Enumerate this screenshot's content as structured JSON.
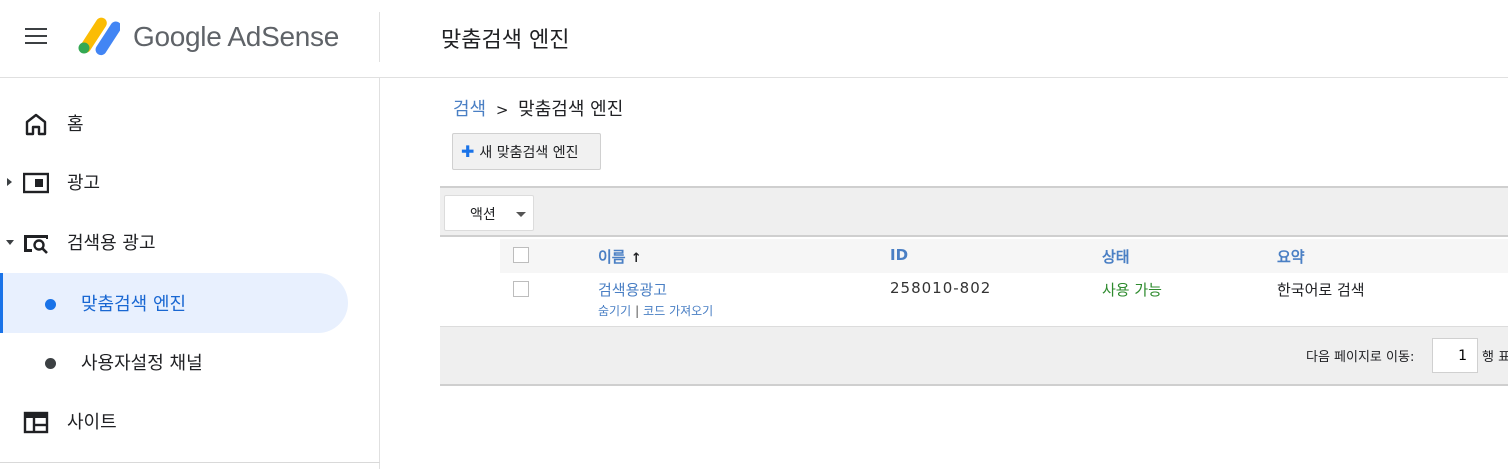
{
  "header": {
    "brand": "Google AdSense",
    "page_title": "맞춤검색 엔진"
  },
  "icons": {
    "menu": "hamburger-menu-icon",
    "logo": "adsense-logo-icon",
    "home": "home-icon",
    "ads": "ad-unit-icon",
    "search_ads": "search-ad-icon",
    "sites": "site-icon",
    "add": "plus-icon",
    "sort": "sort-ascending-icon",
    "dropdown": "dropdown-arrow-icon"
  },
  "colors": {
    "accent": "#1a73e8",
    "link": "#4a7fc4",
    "active_bg": "#e8f0fe",
    "status_ok": "#2e8b2e",
    "logo_yellow": "#fbbc04",
    "logo_green": "#34a853",
    "logo_blue": "#4285f4"
  },
  "sidebar": {
    "items": [
      {
        "label": "홈"
      },
      {
        "label": "광고"
      },
      {
        "label": "검색용 광고"
      },
      {
        "label": "맞춤검색 엔진"
      },
      {
        "label": "사용자설정 채널"
      },
      {
        "label": "사이트"
      }
    ]
  },
  "breadcrumb": {
    "parent": "검색",
    "separator": ">",
    "current": "맞춤검색 엔진"
  },
  "toolbar": {
    "new_button": "새 맞춤검색 엔진",
    "action_button": "액션"
  },
  "table": {
    "columns": [
      "이름",
      "ID",
      "상태",
      "요약"
    ],
    "sort_arrow": "↑",
    "rows": [
      {
        "name": "검색용광고",
        "id": "258010-802",
        "status": "사용 가능",
        "summary": "한국어로 검색",
        "links": [
          "숨기기",
          "코드 가져오기"
        ],
        "link_sep": "|"
      }
    ]
  },
  "pagination": {
    "goto_label": "다음 페이지로 이동:",
    "page_value": "1",
    "suffix": "행 표"
  }
}
